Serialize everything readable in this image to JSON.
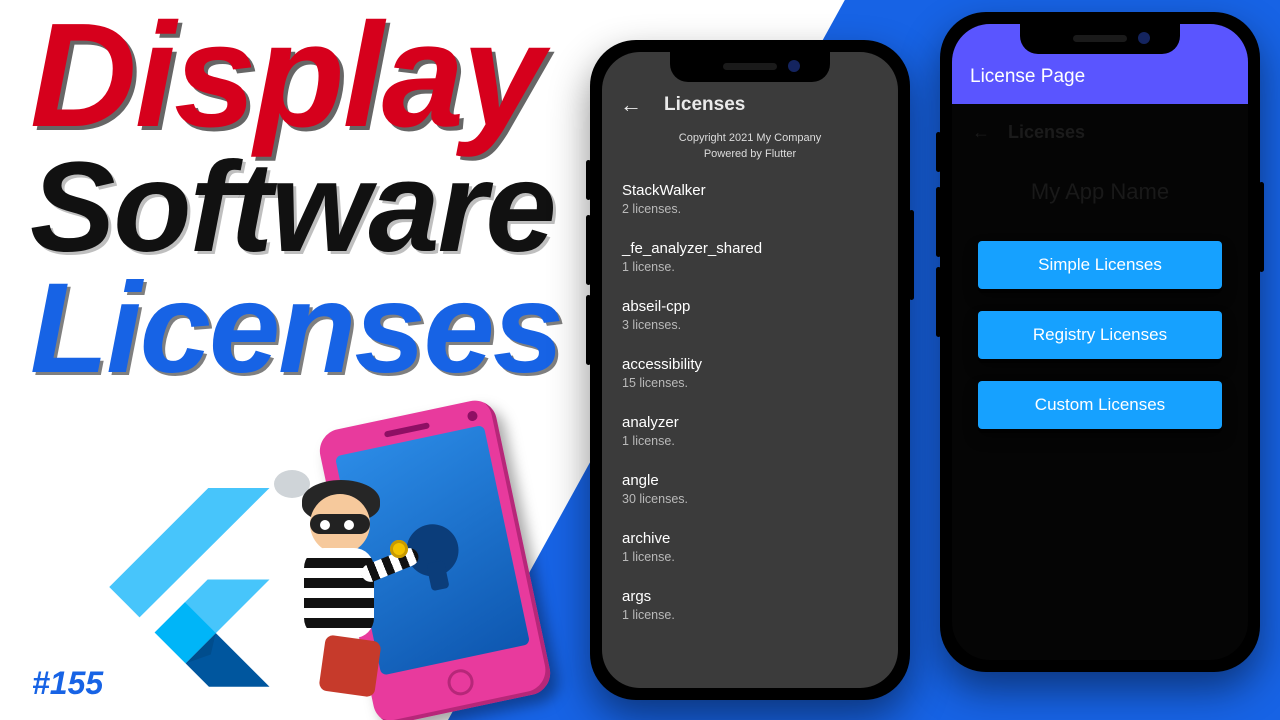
{
  "title": {
    "w1": "Display",
    "w2": "Software",
    "w3": "Licenses"
  },
  "episode": "#155",
  "phone1": {
    "appbar_title": "Licenses",
    "copyright": "Copyright 2021 My Company",
    "powered": "Powered by Flutter",
    "items": [
      {
        "name": "StackWalker",
        "count": "2 licenses."
      },
      {
        "name": "_fe_analyzer_shared",
        "count": "1 license."
      },
      {
        "name": "abseil-cpp",
        "count": "3 licenses."
      },
      {
        "name": "accessibility",
        "count": "15 licenses."
      },
      {
        "name": "analyzer",
        "count": "1 license."
      },
      {
        "name": "angle",
        "count": "30 licenses."
      },
      {
        "name": "archive",
        "count": "1 license."
      },
      {
        "name": "args",
        "count": "1 license."
      }
    ]
  },
  "phone2": {
    "appbar_title": "License Page",
    "dim_back_title": "Licenses",
    "dim_appname": "My App Name",
    "buttons": [
      {
        "label": "Simple Licenses"
      },
      {
        "label": "Registry Licenses"
      },
      {
        "label": "Custom Licenses"
      }
    ]
  }
}
